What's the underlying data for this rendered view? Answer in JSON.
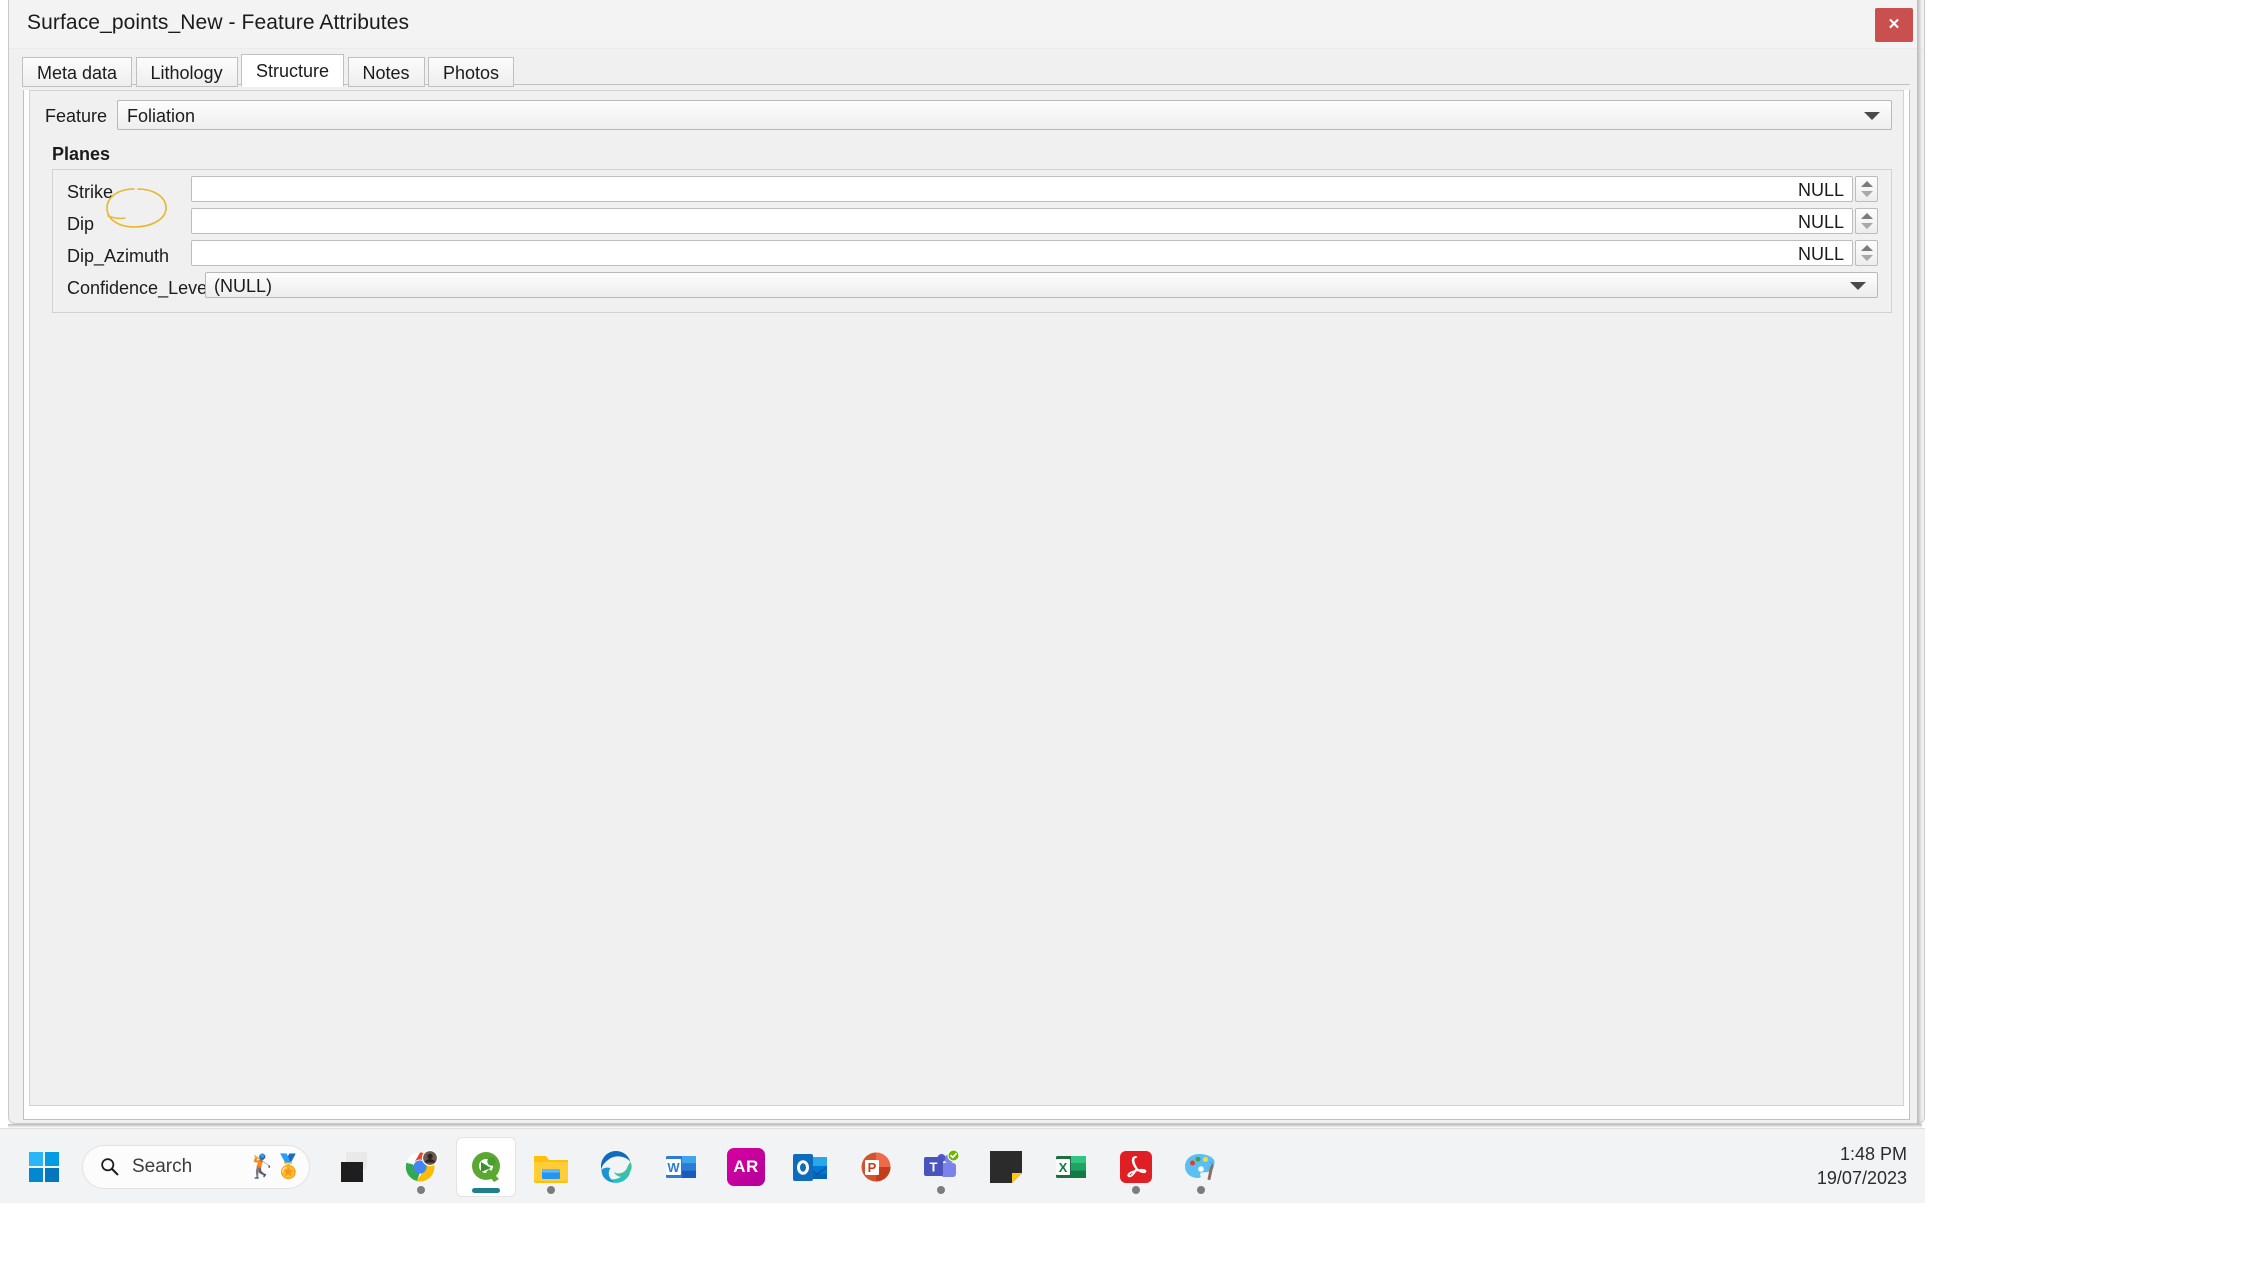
{
  "window": {
    "title": "Surface_points_New - Feature Attributes",
    "close_label": "✕"
  },
  "tabs": [
    {
      "label": "Meta data",
      "active": false
    },
    {
      "label": "Lithology",
      "active": false
    },
    {
      "label": "Structure",
      "active": true
    },
    {
      "label": "Notes",
      "active": false
    },
    {
      "label": "Photos",
      "active": false
    }
  ],
  "form": {
    "feature": {
      "label": "Feature",
      "value": "Foliation"
    },
    "group_title": "Planes",
    "fields": [
      {
        "label": "Strike",
        "value": "NULL",
        "type": "spinbox"
      },
      {
        "label": "Dip",
        "value": "NULL",
        "type": "spinbox"
      },
      {
        "label": "Dip_Azimuth",
        "value": "NULL",
        "type": "spinbox"
      },
      {
        "label": "Confidence_Level",
        "value": "(NULL)",
        "type": "combobox"
      }
    ]
  },
  "annotation": {
    "shape": "hand-drawn-ellipse",
    "color": "#e8b627",
    "target": "Foliation"
  },
  "taskbar": {
    "start": "start-button",
    "search": {
      "placeholder": "Search",
      "emoji": "🏌️🏅"
    },
    "apps": [
      {
        "name": "lenovo-vantage",
        "label": "",
        "running": false,
        "active": false
      },
      {
        "name": "google-chrome",
        "label": "",
        "running": true,
        "active": false
      },
      {
        "name": "qgis",
        "label": "",
        "running": true,
        "active": true
      },
      {
        "name": "file-explorer",
        "label": "",
        "running": true,
        "active": false
      },
      {
        "name": "microsoft-edge",
        "label": "",
        "running": false,
        "active": false
      },
      {
        "name": "microsoft-word",
        "label": "W",
        "running": false,
        "active": false
      },
      {
        "name": "adobe-ar",
        "label": "AR",
        "running": false,
        "active": false
      },
      {
        "name": "microsoft-outlook",
        "label": "O",
        "running": false,
        "active": false
      },
      {
        "name": "microsoft-powerpoint",
        "label": "P",
        "running": false,
        "active": false
      },
      {
        "name": "microsoft-teams",
        "label": "T",
        "running": true,
        "active": false
      },
      {
        "name": "sticky-notes",
        "label": "",
        "running": false,
        "active": false
      },
      {
        "name": "microsoft-excel",
        "label": "X",
        "running": false,
        "active": false
      },
      {
        "name": "adobe-acrobat",
        "label": "",
        "running": true,
        "active": false
      },
      {
        "name": "paint",
        "label": "",
        "running": true,
        "active": false
      }
    ],
    "clock": {
      "time": "1:48 PM",
      "date": "19/07/2023"
    }
  },
  "colors": {
    "close_red": "#ca5050",
    "window_chrome": "#f0f0f0",
    "annotation_yellow": "#e8b627",
    "qgis_active_bar": "#1e7f8e"
  }
}
